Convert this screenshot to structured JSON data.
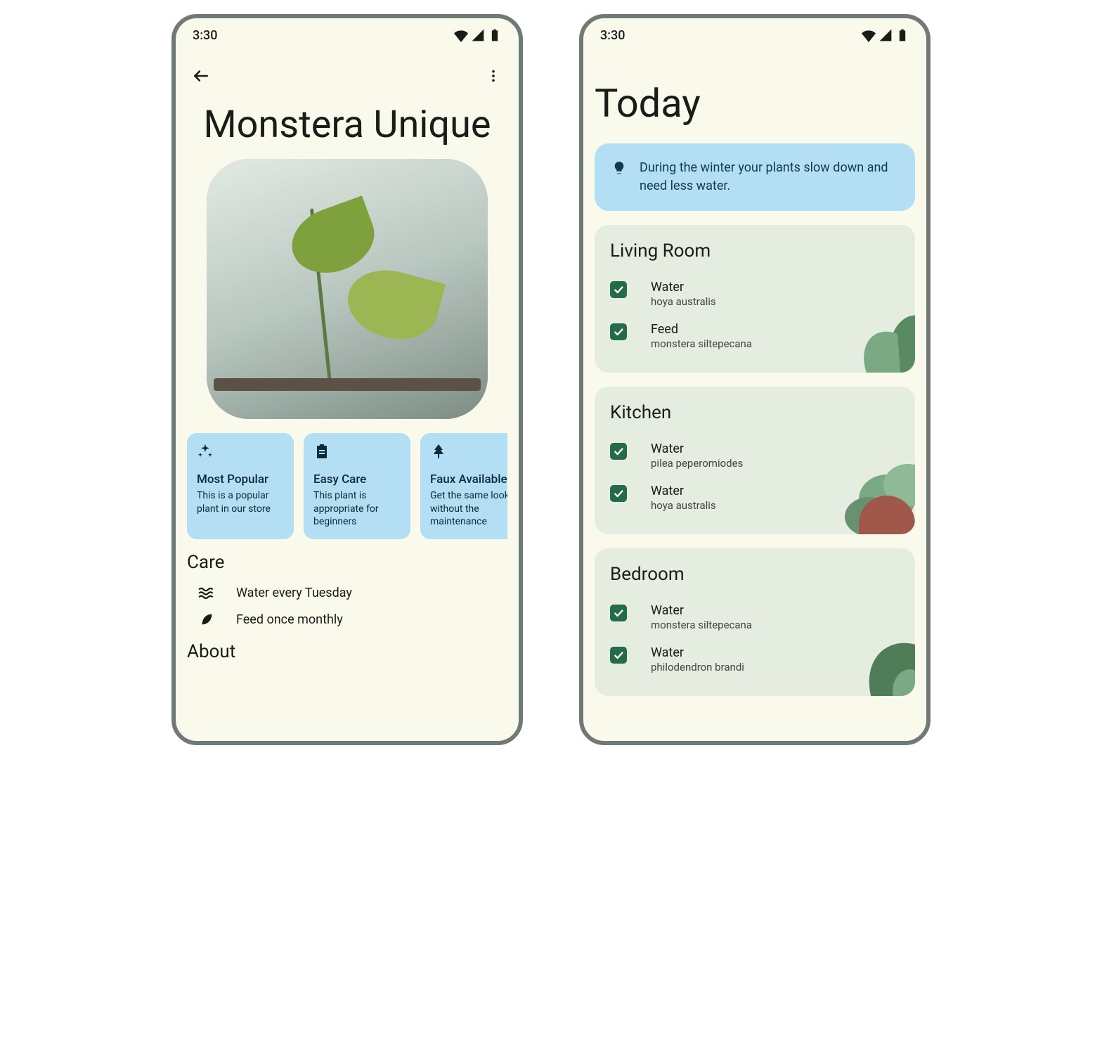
{
  "status": {
    "time": "3:30"
  },
  "screen1": {
    "title": "Monstera Unique",
    "chips": [
      {
        "icon": "sparkle",
        "title": "Most Popular",
        "desc": "This is a popular plant in our store"
      },
      {
        "icon": "clipboard",
        "title": "Easy Care",
        "desc": "This plant is appropriate for beginners"
      },
      {
        "icon": "tree",
        "title": "Faux Available",
        "desc": "Get the same look without the maintenance"
      }
    ],
    "care_heading": "Care",
    "care_items": [
      {
        "icon": "water",
        "text": "Water every Tuesday"
      },
      {
        "icon": "leaf",
        "text": "Feed once monthly"
      }
    ],
    "about_heading": "About"
  },
  "screen2": {
    "title": "Today",
    "tip": "During the winter your plants slow down and need less water.",
    "rooms": [
      {
        "name": "Living Room",
        "tasks": [
          {
            "action": "Water",
            "plant": "hoya australis",
            "checked": true
          },
          {
            "action": "Feed",
            "plant": "monstera siltepecana",
            "checked": true
          }
        ]
      },
      {
        "name": "Kitchen",
        "tasks": [
          {
            "action": "Water",
            "plant": "pilea peperomiodes",
            "checked": true
          },
          {
            "action": "Water",
            "plant": "hoya australis",
            "checked": true
          }
        ]
      },
      {
        "name": "Bedroom",
        "tasks": [
          {
            "action": "Water",
            "plant": "monstera siltepecana",
            "checked": true
          },
          {
            "action": "Water",
            "plant": "philodendron brandi",
            "checked": true
          }
        ]
      }
    ]
  }
}
